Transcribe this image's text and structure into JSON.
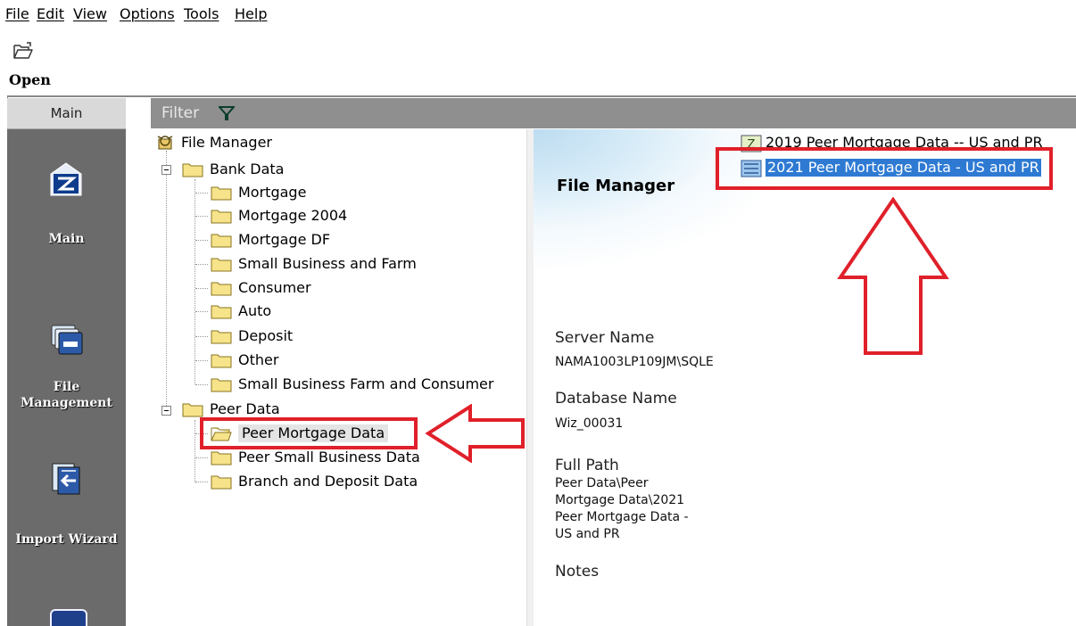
{
  "menu": [
    "File",
    "Edit",
    "View",
    "Options",
    "Tools",
    "Help"
  ],
  "toolbar": {
    "open_label": "Open"
  },
  "nav": {
    "header": "Main",
    "items": [
      {
        "label": "Main",
        "icon": "main-icon"
      },
      {
        "label": "File Management",
        "icon": "file-management-icon"
      },
      {
        "label": "Import Wizard",
        "icon": "import-wizard-icon"
      }
    ]
  },
  "filter": {
    "label": "Filter",
    "icon": "funnel-icon"
  },
  "tree": {
    "root": "File Manager",
    "bank_data": {
      "label": "Bank Data",
      "children": [
        "Mortgage",
        "Mortgage 2004",
        "Mortgage DF",
        "Small Business and Farm",
        "Consumer",
        "Auto",
        "Deposit",
        "Other",
        "Small Business Farm and Consumer"
      ]
    },
    "peer_data": {
      "label": "Peer Data",
      "children": [
        "Peer Mortgage Data",
        "Peer Small Business Data",
        "Branch and Deposit Data"
      ],
      "selected": "Peer Mortgage Data"
    }
  },
  "details": {
    "title": "File Manager",
    "server_label": "Server Name",
    "server_value": "NAMA1003LP109JM\\SQLE",
    "db_label": "Database Name",
    "db_value": "Wiz_00031",
    "path_label": "Full Path",
    "path_line1": "Peer Data\\Peer",
    "path_line2": "Mortgage Data\\2021",
    "path_line3": "Peer Mortgage Data -",
    "path_line4": "US and PR",
    "notes_label": "Notes"
  },
  "files": [
    {
      "name": "2019 Peer Mortgage Data -- US and PR",
      "selected": false
    },
    {
      "name": "2021 Peer Mortgage Data - US and PR",
      "selected": true
    }
  ],
  "colors": {
    "annotation": "#e0202a",
    "selection": "#2e7ad3",
    "nav_bg": "#6b6b6b",
    "filter_bg": "#8f8f8f"
  }
}
